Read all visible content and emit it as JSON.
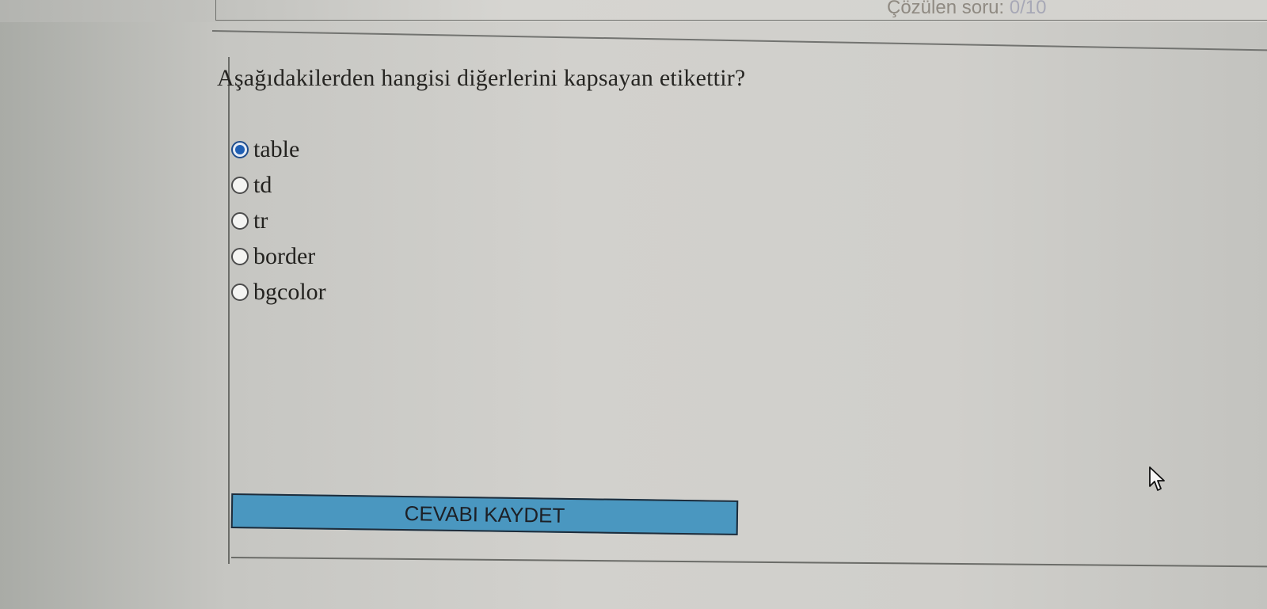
{
  "header": {
    "solved_label": "Çözülen soru:",
    "solved_count": "0/10"
  },
  "quiz": {
    "question": "Aşağıdakilerden hangisi diğerlerini kapsayan etikettir?",
    "selected_option": "table",
    "options": [
      {
        "label": "table",
        "checked": true
      },
      {
        "label": "td",
        "checked": false
      },
      {
        "label": "tr",
        "checked": false
      },
      {
        "label": "border",
        "checked": false
      },
      {
        "label": "bgcolor",
        "checked": false
      }
    ]
  },
  "actions": {
    "save_label": "CEVABI KAYDET"
  },
  "colors": {
    "button_fill": "#4a97c0",
    "radio_selected": "#1f5fb4"
  },
  "icons": {
    "cursor": "mouse-pointer-icon"
  }
}
